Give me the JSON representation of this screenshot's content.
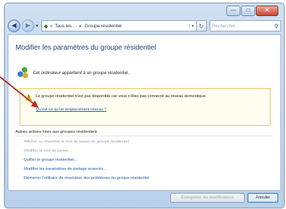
{
  "toolbar": {
    "back_glyph": "◀",
    "forward_glyph": "▶",
    "nav_drop_glyph": "▾",
    "address": {
      "prefix": "«",
      "crumb1": "Tous les ...",
      "separator": "▸",
      "crumb2": "Groupe résidentiel",
      "drop_glyph": "▾"
    },
    "refresh_glyph": "↻",
    "search_placeholder": "Rechercher",
    "search_glyph": "⚲"
  },
  "caption_buttons": {
    "minimize": "—",
    "maximize": "□",
    "close": "✕"
  },
  "page_title": "Modifier les paramètres du groupe résidentiel",
  "owner_text": "Cet ordinateur appartient à un groupe résidentiel.",
  "warning": {
    "icon_glyph": "!",
    "text": "Le groupe résidentiel n'est pas disponible car vous n'êtes pas connecté au réseau domestique.",
    "link": "Qu'est-ce qu'un emplacement réseau ?"
  },
  "actions_header": "Autres actions liées aux groupes résidentiels",
  "actions": [
    "Afficher ou imprimer le mot de passe du groupe résidentiel",
    "Modifier le mot de passe...",
    "Quitter le groupe résidentiel...",
    "Modifier les paramètres de partage avancés...",
    "Démarrer l'utilitaire de résolution des problèmes du groupe résidentiel"
  ],
  "buttons": {
    "save": "Enregistrer les modifications",
    "cancel": "Annuler"
  },
  "colors": {
    "title_blue": "#1e3f7a",
    "link_blue": "#1a56b3",
    "annotation_arrow": "#c0281c"
  }
}
